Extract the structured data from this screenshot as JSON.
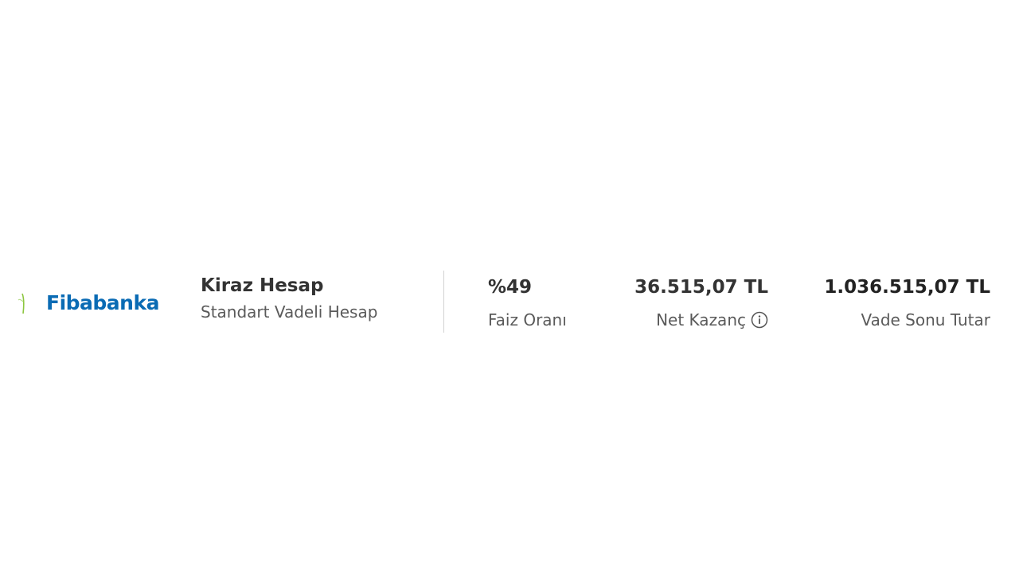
{
  "offer": {
    "bank_name": "Fibabanka",
    "brand_color": "#0a6bb4",
    "product_name": "Kiraz Hesap",
    "product_type": "Standart Vadeli Hesap",
    "interest_rate": {
      "value": "%49",
      "label": "Faiz Oranı"
    },
    "net_gain": {
      "value": "36.515,07 TL",
      "label": "Net Kazanç",
      "icon": "info-icon"
    },
    "maturity_total": {
      "value": "1.036.515,07 TL",
      "label": "Vade Sonu Tutar"
    }
  }
}
